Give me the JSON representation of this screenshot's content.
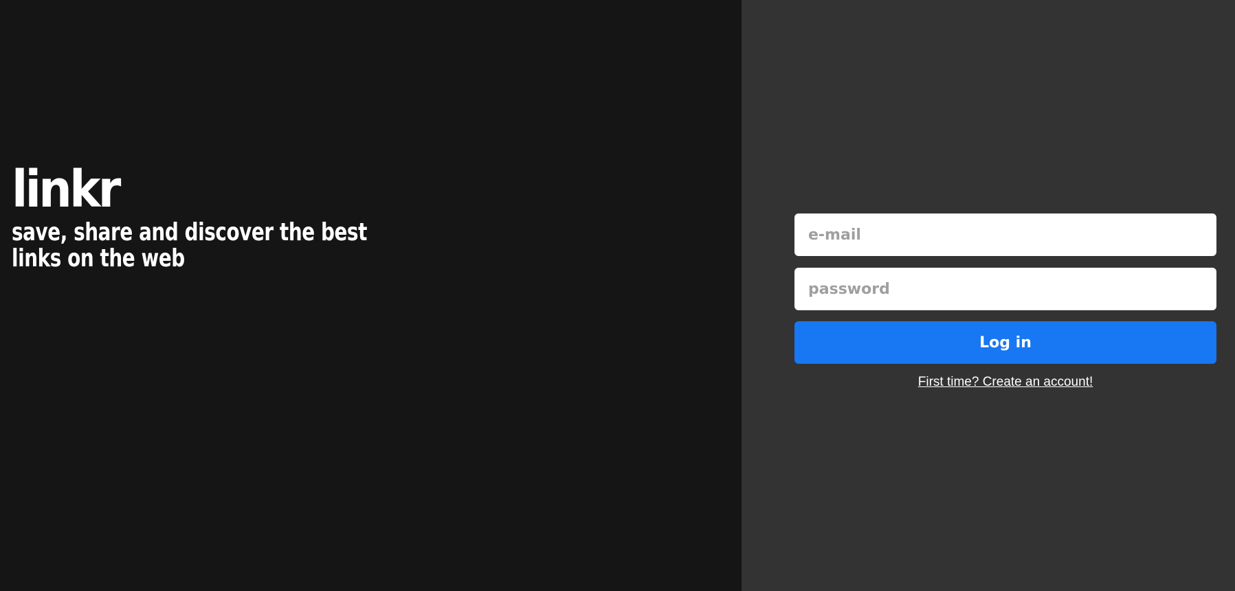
{
  "brand": {
    "logo": "linkr",
    "tagline": "save, share and discover the best links on the web"
  },
  "form": {
    "email_placeholder": "e-mail",
    "password_placeholder": "password",
    "login_label": "Log in",
    "signup_link": "First time? Create an account!"
  },
  "colors": {
    "left_background": "#151515",
    "right_background": "#333333",
    "button_primary": "#1877f2",
    "text": "#ffffff"
  }
}
